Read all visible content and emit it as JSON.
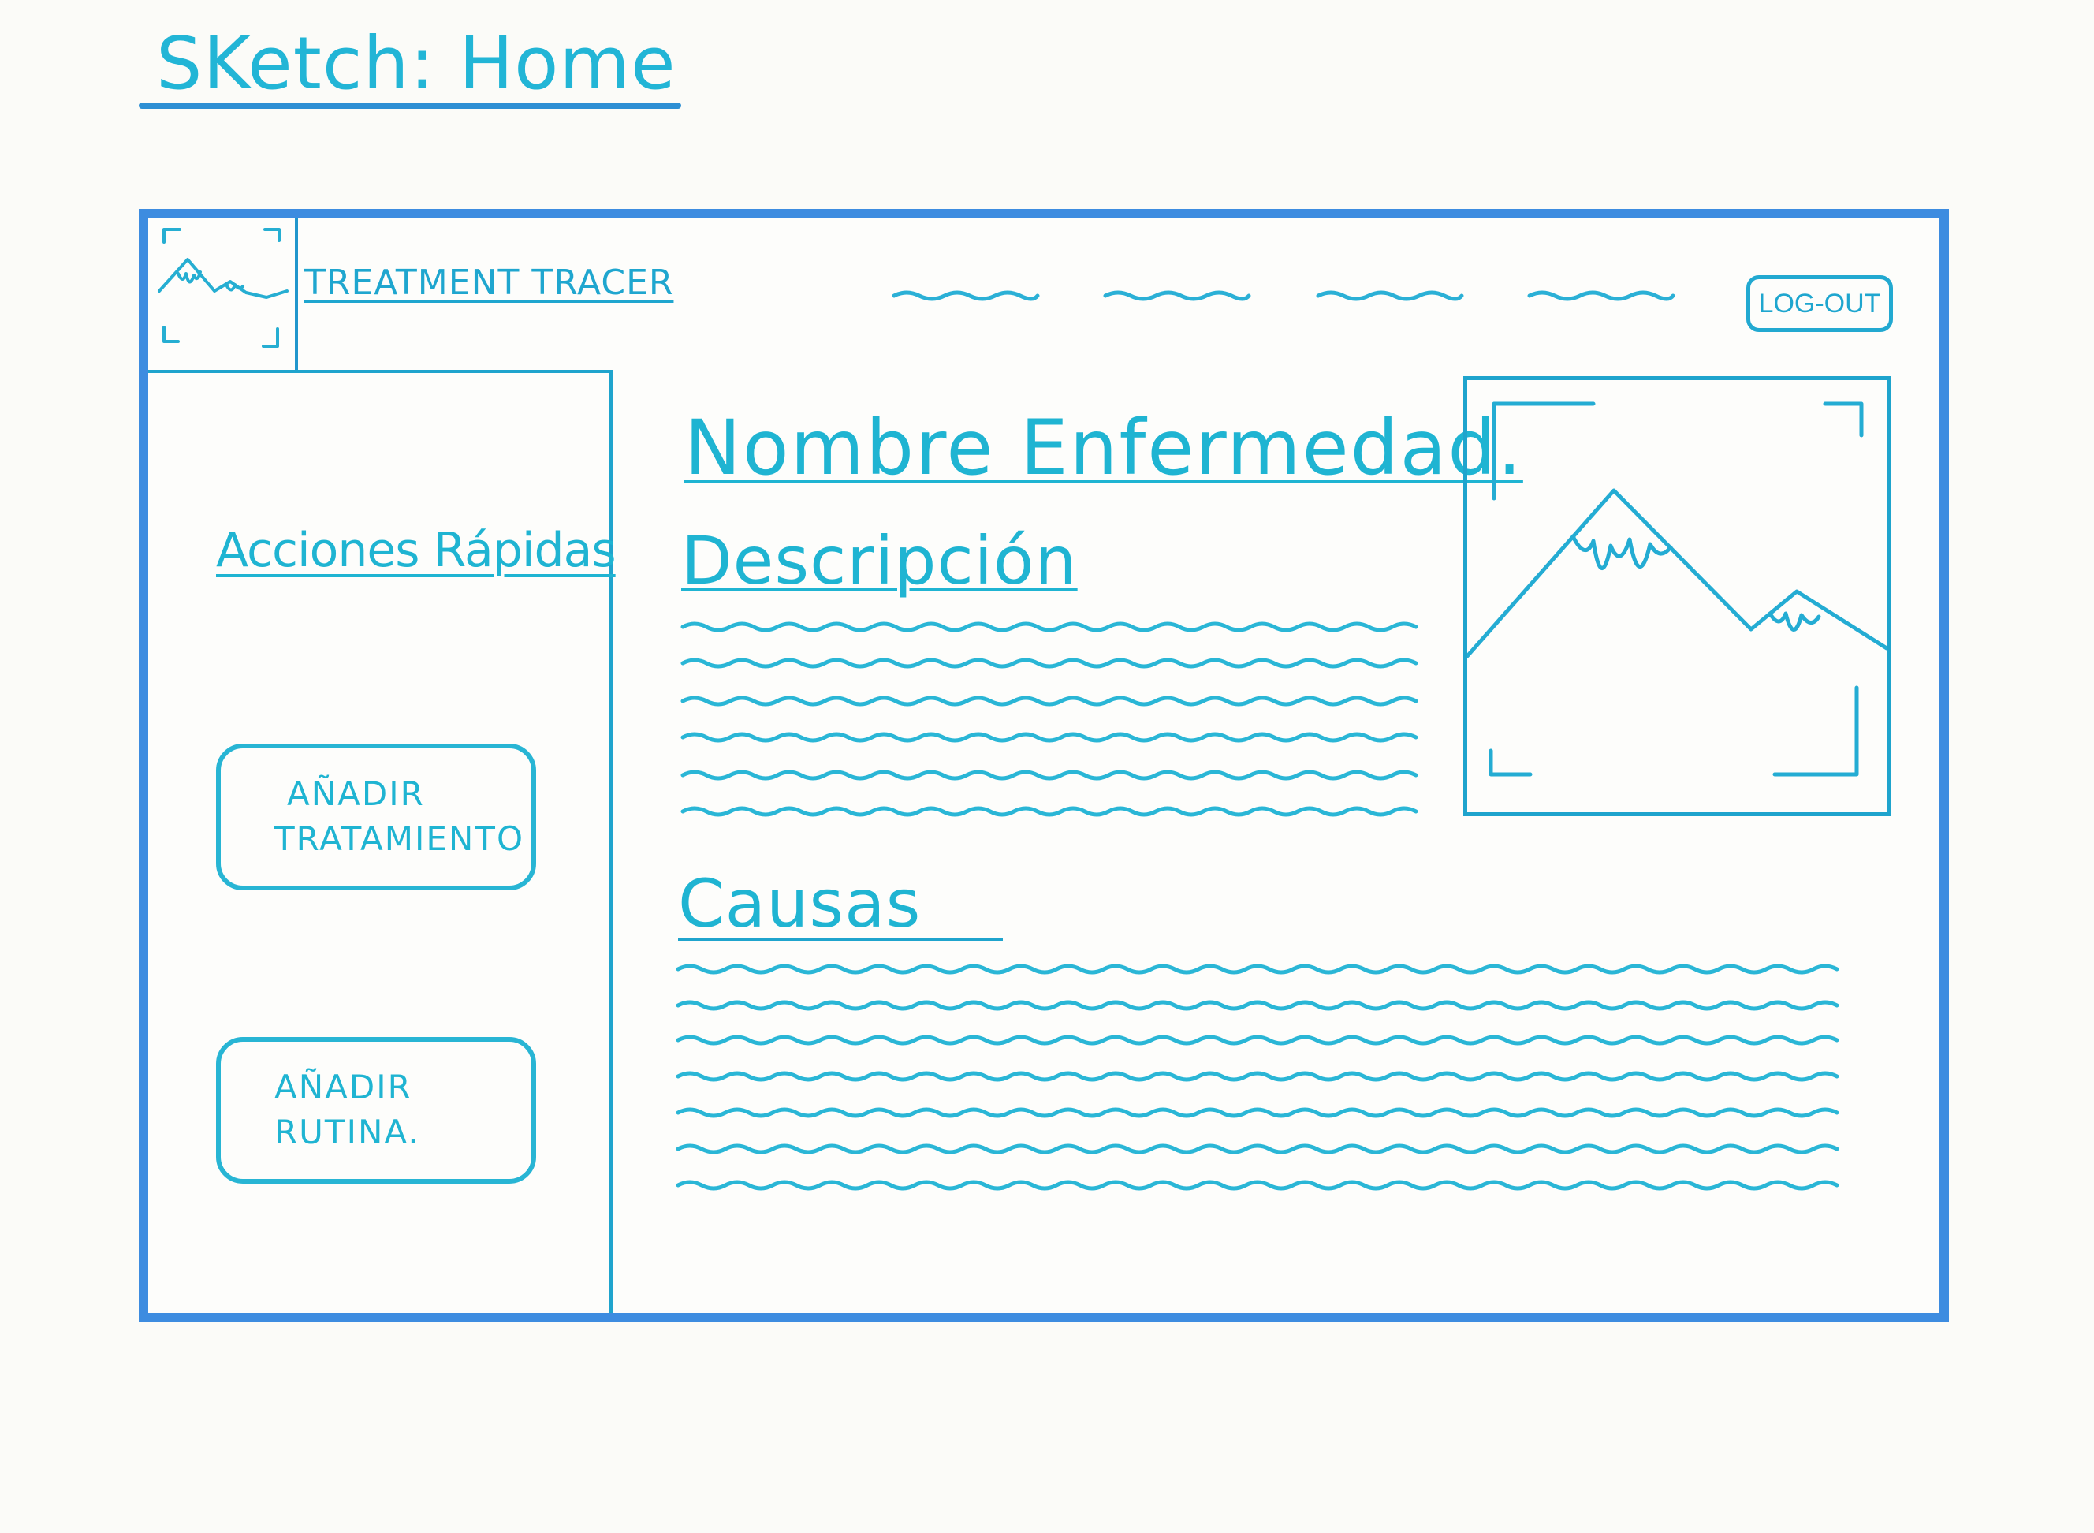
{
  "sketch": {
    "title": "SKetch: Home"
  },
  "header": {
    "app_title": "TREATMENT TRACER",
    "nav_items": [
      "",
      "",
      "",
      ""
    ],
    "logout_label": "LOG-OUT"
  },
  "sidebar": {
    "title": "Acciones Rápidas",
    "buttons": [
      {
        "line1": "AÑADIR",
        "line2": "TRATAMIENTO"
      },
      {
        "line1": "AÑADIR",
        "line2": "RUTINA."
      }
    ]
  },
  "main": {
    "disease_name": "Nombre Enfermedad.",
    "description_title": "Descripción",
    "causes_title": "Causas"
  },
  "icons": {
    "logo": "mountain-image-icon",
    "hero": "mountain-image-icon"
  },
  "colors": {
    "ink": "#22b7d4",
    "frame": "#3d8ce0"
  }
}
